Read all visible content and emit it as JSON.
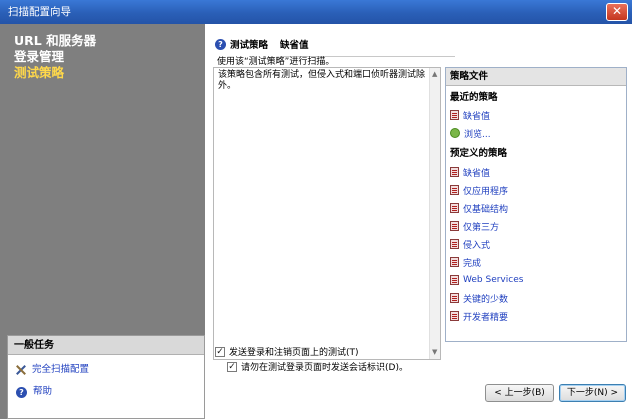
{
  "window": {
    "title": "扫描配置向导",
    "close_label": "✕"
  },
  "sidebar": {
    "nav": [
      {
        "label": "URL 和服务器",
        "active": false
      },
      {
        "label": "登录管理",
        "active": false
      },
      {
        "label": "测试策略",
        "active": true
      }
    ],
    "tasks": {
      "header": "一般任务",
      "items": [
        {
          "label": "完全扫描配置",
          "icon": "tools-icon"
        },
        {
          "label": "帮助",
          "icon": "help-icon"
        }
      ]
    }
  },
  "main": {
    "title": "测试策略",
    "current_policy": "缺省值",
    "subtitle": "使用该“测试策略”进行扫描。",
    "description": "该策略包含所有测试，但侵入式和端口侦听器测试除外。",
    "policy_panel": {
      "header": "策略文件",
      "recent_title": "最近的策略",
      "recent": [
        "缺省值",
        "浏览..."
      ],
      "predefined_title": "预定义的策略",
      "predefined": [
        "缺省值",
        "仅应用程序",
        "仅基础结构",
        "仅第三方",
        "侵入式",
        "完成",
        "Web Services",
        "关键的少数",
        "开发者精要"
      ]
    },
    "checkbox_send_tests": {
      "label": "发送登录和注销页面上的测试(T)",
      "checked": true
    },
    "checkbox_no_session": {
      "label": "请勿在测试登录页面时发送会话标识(D)。",
      "checked": true
    },
    "buttons": {
      "back": "< 上一步(B)",
      "next": "下一步(N) >"
    }
  },
  "colors": {
    "sidebar_bg": "#7f7f7f",
    "active_nav": "#ffd84a",
    "link": "#1f3fbf",
    "titlebar": "#2a5fb7"
  }
}
